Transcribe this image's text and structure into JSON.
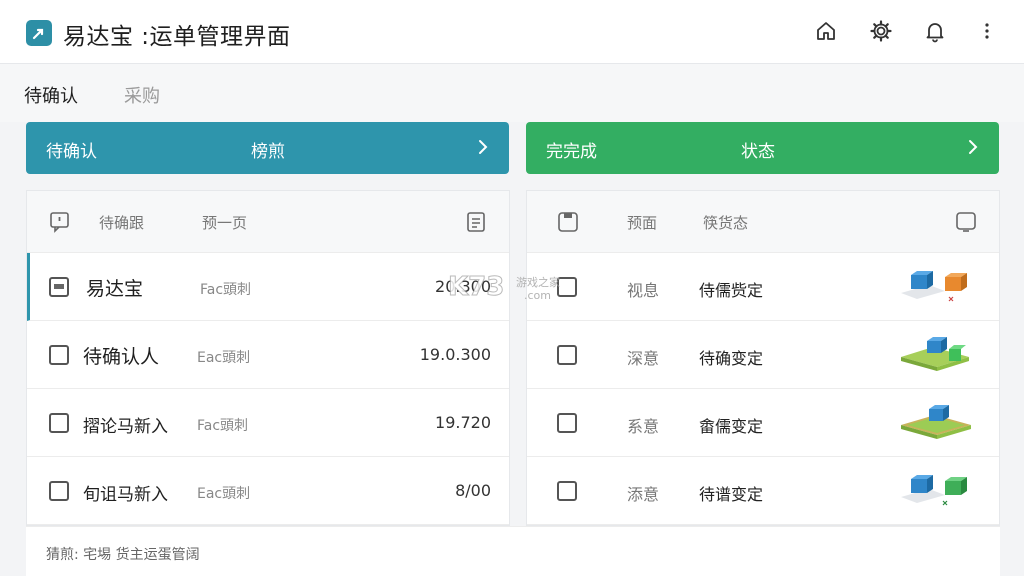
{
  "app": {
    "title": "易达宝 :运单管理畀面"
  },
  "topbar": {
    "icons": [
      "home-icon",
      "gear-icon",
      "bell-icon",
      "more-vertical-icon"
    ]
  },
  "tabs": [
    {
      "label": "待确认",
      "active": true
    },
    {
      "label": "采购",
      "active": false
    }
  ],
  "banners": [
    {
      "label": "待确认",
      "value": "榜煎",
      "color": "#2e95ac"
    },
    {
      "label": "完完成",
      "value": "状态",
      "color": "#33ae62"
    }
  ],
  "left_table": {
    "headers": [
      "待确跟",
      "预一页"
    ],
    "rows": [
      {
        "name": "易达宝",
        "sub": "Fac頭刺",
        "value": "20.300",
        "checked": true,
        "selected": true
      },
      {
        "name": "待确认人",
        "sub": "Eac頭刺",
        "value": "19.0.300",
        "checked": false,
        "selected": false
      },
      {
        "name": "摺论马新入",
        "sub": "Fac頭刺",
        "value": "19.720",
        "checked": false,
        "selected": false
      },
      {
        "name": "旬诅马新入",
        "sub": "Eac頭刺",
        "value": "8/00",
        "checked": false,
        "selected": false
      }
    ]
  },
  "right_table": {
    "headers": [
      "预面",
      "筷货态"
    ],
    "rows": [
      {
        "type": "视息",
        "status": "侍儒赀定",
        "graphic": "two-boxes"
      },
      {
        "type": "深意",
        "status": "待确变定",
        "graphic": "platform-boxes"
      },
      {
        "type": "系意",
        "status": "畬儒变定",
        "graphic": "platform-box"
      },
      {
        "type": "添意",
        "status": "待谱变定",
        "graphic": "box-pair"
      }
    ]
  },
  "footer": {
    "text": "猜煎: 宅埸  货主运蛋管阔"
  },
  "watermark": {
    "text": "K73",
    "sub": "游戏之家",
    "url": ".com"
  },
  "colors": {
    "accent_blue": "#2e95ac",
    "accent_green": "#33ae62"
  }
}
